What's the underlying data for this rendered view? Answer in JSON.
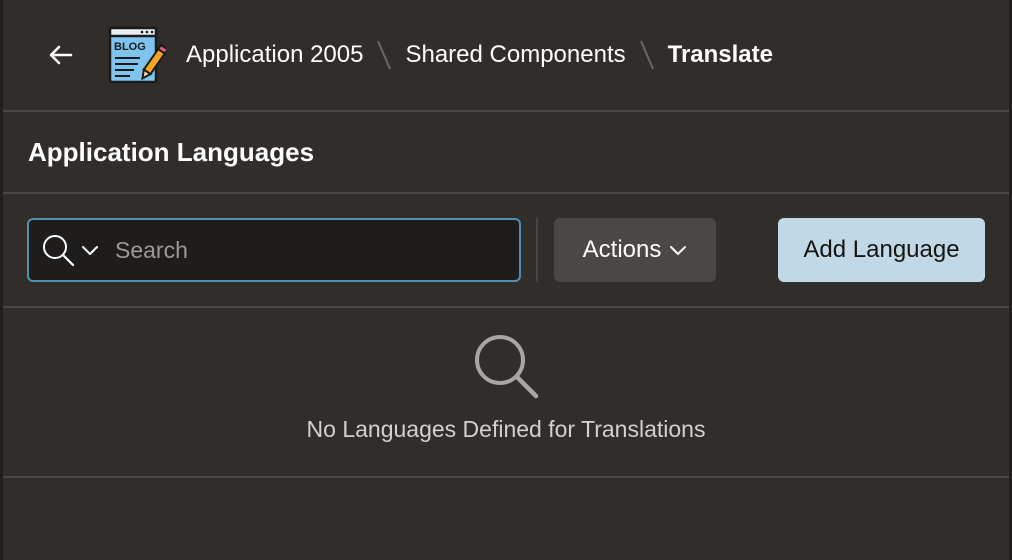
{
  "header": {
    "logo_text": "BLOG",
    "breadcrumb": [
      {
        "label": "Application 2005"
      },
      {
        "label": "Shared Components"
      },
      {
        "label": "Translate"
      }
    ]
  },
  "region": {
    "title": "Application Languages"
  },
  "toolbar": {
    "search_placeholder": "Search",
    "search_value": "",
    "actions_label": "Actions",
    "add_language_label": "Add Language"
  },
  "empty_state": {
    "message": "No Languages Defined for Translations"
  },
  "colors": {
    "background": "#312d2a",
    "search_border": "#4f8fb0",
    "primary_button": "#c1d9e6",
    "secondary_button": "#4b4744"
  }
}
